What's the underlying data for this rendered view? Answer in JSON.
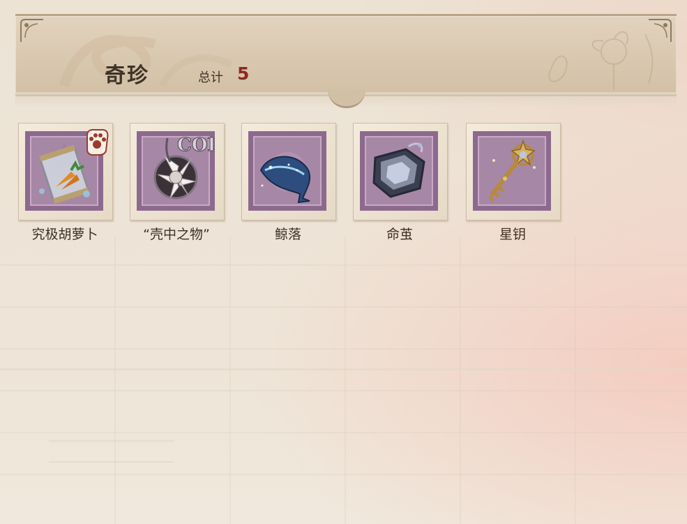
{
  "header": {
    "title": "奇珍",
    "total_label": "总计",
    "total_value": "5"
  },
  "items": [
    {
      "label": "究极胡萝卜",
      "icon": "carrot-jar-icon",
      "has_badge": true
    },
    {
      "label": "“壳中之物”",
      "icon": "shell-flower-icon"
    },
    {
      "label": "鲸落",
      "icon": "whale-icon"
    },
    {
      "label": "命茧",
      "icon": "cocoon-icon"
    },
    {
      "label": "星钥",
      "icon": "star-key-icon"
    }
  ],
  "colors": {
    "stamp_purple": "#8c6a8e",
    "count_red": "#8a2a22",
    "text_dark": "#3e3328"
  }
}
